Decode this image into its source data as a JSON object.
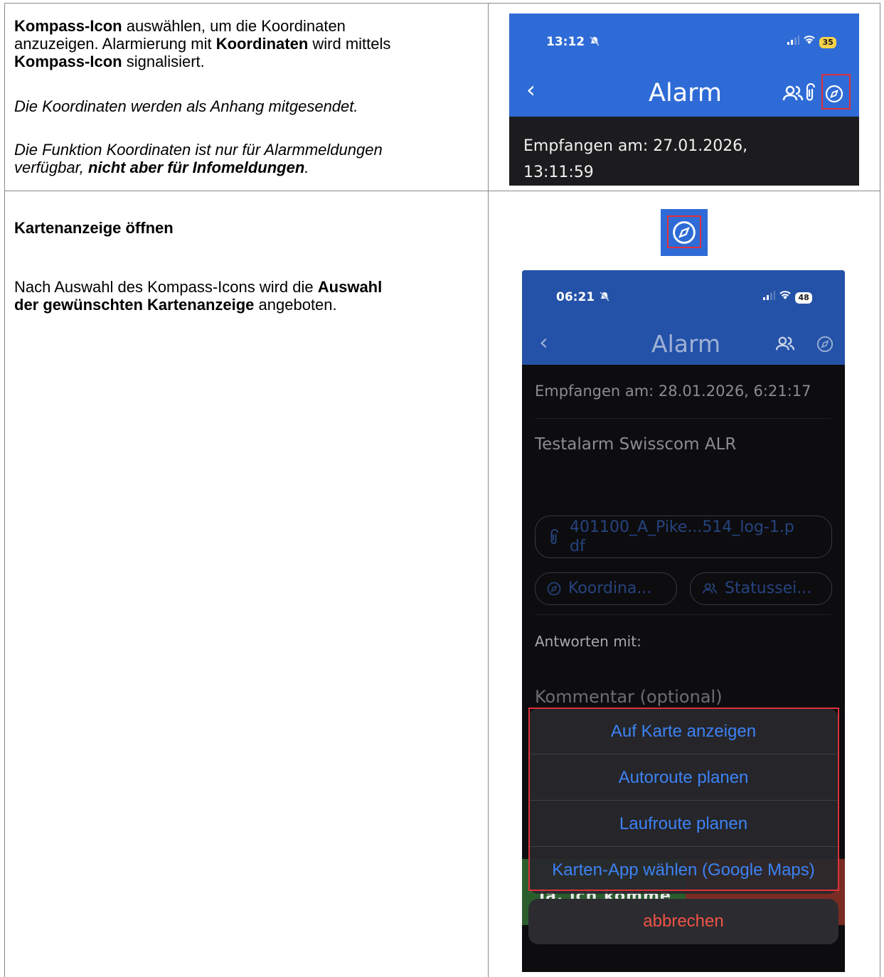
{
  "row1": {
    "line1_bold": "Kompass-Icon",
    "line1_rest": " auswählen, um die Koordinaten",
    "line2": "anzuzeigen. Alarmierung mit ",
    "line2_bold": "Koordinaten",
    "line2_rest": " wird mittels",
    "line3_bold": "Kompass-Icon",
    "line3_rest": " signalisiert.",
    "note1": "Die Koordinaten werden als Anhang mitgesendet.",
    "note2_line1": "Die Funktion Koordinaten ist nur für Alarmmeldungen",
    "note2_line2_a": "verfügbar, ",
    "note2_line2_b": "nicht aber für Infomeldungen",
    "note2_line2_c": "."
  },
  "row2": {
    "heading": "Kartenanzeige öffnen",
    "para_a": "Nach Auswahl des Kompass-Icons wird die ",
    "para_b": "Auswahl",
    "para_c": "der gewünschten Kartenanzeige",
    "para_d": " angeboten."
  },
  "screen1": {
    "time": "13:12",
    "battery": "35",
    "title": "Alarm",
    "received_line1": "Empfangen am: 27.01.2026,",
    "received_line2": "13:11:59"
  },
  "screen2": {
    "time": "06:21",
    "battery": "48",
    "title": "Alarm",
    "received": "Empfangen am: 28.01.2026, 6:21:17",
    "message": "Testalarm Swisscom ALR",
    "attachment_line1": "401100_A_Pike...514_log-1.p",
    "attachment_line2": "df",
    "coords_chip": "Koordina...",
    "status_chip": "Statussei...",
    "answer_label": "Antworten mit:",
    "comment_placeholder": "Kommentar (optional)",
    "yes_button": "Ja, ich komme",
    "actions": [
      "Auf Karte anzeigen",
      "Autoroute planen",
      "Laufroute planen",
      "Karten-App wählen (Google Maps)"
    ],
    "cancel": "abbrechen"
  },
  "colors": {
    "nav_blue": "#2e6bd6",
    "nav_blue_dark": "#2452a8",
    "action_blue": "#3d82f4",
    "cancel_red": "#ef5346",
    "highlight_red": "#e0303b"
  },
  "icons": [
    "compass-icon",
    "users-icon",
    "paperclip-icon",
    "back-chevron-icon",
    "bell-slash-icon",
    "signal-icon",
    "wifi-icon",
    "battery-icon"
  ]
}
